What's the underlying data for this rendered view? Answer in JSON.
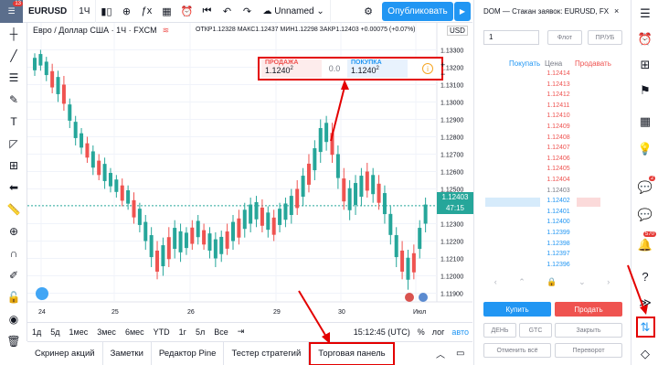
{
  "topbar": {
    "avatar_badge": "13",
    "symbol": "EURUSD",
    "interval": "1Ч",
    "unnamed_label": "Unnamed",
    "publish_label": "Опубликовать"
  },
  "legend": {
    "name": "Евро / Доллар США · 1Ч · FXCM",
    "ohlc": "ОТКР1.12328  МАКС1.12437  МИН1.12298  ЗАКР1.12403  +0.00075 (+0.07%)",
    "currency": "USD"
  },
  "trade_widget": {
    "sell_label": "ПРОДАЖА",
    "sell_price": "1.1240",
    "sell_sup": "2",
    "spread": "0.0",
    "buy_label": "ПОКУПКА",
    "buy_price": "1.1240",
    "buy_sup": "2",
    "info": "i",
    "plus": "+",
    "minus": "−"
  },
  "axis": {
    "y_labels": [
      "1.13300",
      "1.13200",
      "1.13100",
      "1.13000",
      "1.12900",
      "1.12800",
      "1.12700",
      "1.12600",
      "1.12500",
      "1.12300",
      "1.12200",
      "1.12100",
      "1.12000",
      "1.11900"
    ],
    "last_price": "1.12403",
    "countdown": "47:15",
    "x_labels": [
      "24",
      "25",
      "26",
      "29",
      "30",
      "Июл"
    ]
  },
  "timeframes": {
    "items": [
      "1д",
      "5д",
      "1мес",
      "3мес",
      "6мес",
      "YTD",
      "1г",
      "5л",
      "Все"
    ],
    "time": "15:12:45 (UTC)",
    "pct": "%",
    "log": "лог",
    "auto": "авто"
  },
  "bottom_tabs": [
    "Скринер акций",
    "Заметки",
    "Редактор Pine",
    "Тестер стратегий",
    "Торговая панель"
  ],
  "dom": {
    "title": "DOM — Стакан заявок: EURUSD, FX",
    "qty": "1",
    "limit_btn": "Флот",
    "stop_btn": "ПР/УБ",
    "col_buy": "Покупать",
    "col_price": "Цена",
    "col_sell": "Продавать",
    "prices": [
      "1.12414",
      "1.12413",
      "1.12412",
      "1.12411",
      "1.12410",
      "1.12409",
      "1.12408",
      "1.12407",
      "1.12406",
      "1.12405",
      "1.12404",
      "1.12403",
      "1.12402",
      "1.12401",
      "1.12400",
      "1.12399",
      "1.12398",
      "1.12397",
      "1.12396"
    ],
    "buy_btn": "Купить",
    "sell_btn": "Продать",
    "flat_btn": "ДЕНЬ",
    "gtc_btn": "GTC",
    "close_btn": "Закрыть",
    "cancel_all": "Отменить всё",
    "reverse": "Переворот"
  },
  "sidebar": {
    "chat_badge": "2",
    "notif_badge": "570"
  },
  "chart_data": {
    "type": "candlestick",
    "title": "Евро / Доллар США · 1Ч · FXCM",
    "ylim": [
      1.1185,
      1.1335
    ],
    "x_ticks": [
      "24",
      "25",
      "26",
      "29",
      "30",
      "Июл"
    ],
    "last_price": 1.12403
  }
}
